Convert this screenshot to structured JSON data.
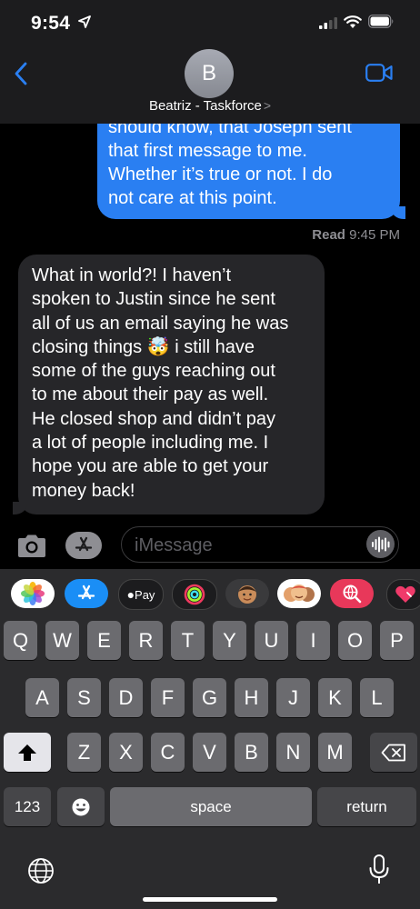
{
  "status_bar": {
    "time": "9:54"
  },
  "header": {
    "avatar_initial": "B",
    "contact_name": "Beatriz - Taskforce",
    "chevron": ">"
  },
  "messages": {
    "outgoing": {
      "lines": [
        "should know, that Joseph sent",
        "that first message to me.",
        "Whether it’s true or not. I do",
        "not care at this point."
      ]
    },
    "read_receipt": {
      "label": "Read",
      "time": "9:45 PM"
    },
    "incoming": {
      "lines": [
        "What in world?!  I haven’t",
        "spoken to Justin since he sent",
        "all of us an email saying he was",
        "closing things 🤯 i still have",
        "some of the guys reaching out",
        "to me about their pay as well.",
        "He closed shop and didn’t pay",
        "a lot of people including me. I",
        "hope you are able to get your",
        "money back!"
      ]
    }
  },
  "composer": {
    "placeholder": "iMessage"
  },
  "app_strip": {
    "items": [
      {
        "name": "photos-app-icon",
        "label": ""
      },
      {
        "name": "app-store-icon",
        "label": ""
      },
      {
        "name": "apple-pay-icon",
        "label": "Pay"
      },
      {
        "name": "activity-icon",
        "label": ""
      },
      {
        "name": "memoji-icon",
        "label": ""
      },
      {
        "name": "memoji-stickers-icon",
        "label": ""
      },
      {
        "name": "image-search-icon",
        "label": ""
      },
      {
        "name": "digital-touch-icon",
        "label": ""
      }
    ]
  },
  "keyboard": {
    "row1": [
      "Q",
      "W",
      "E",
      "R",
      "T",
      "Y",
      "U",
      "I",
      "O",
      "P"
    ],
    "row2": [
      "A",
      "S",
      "D",
      "F",
      "G",
      "H",
      "J",
      "K",
      "L"
    ],
    "row3": [
      "Z",
      "X",
      "C",
      "V",
      "B",
      "N",
      "M"
    ],
    "numbers_label": "123",
    "space_label": "space",
    "return_label": "return"
  },
  "colors": {
    "outgoing_bubble": "#2a7ff2",
    "incoming_bubble": "#262629",
    "accent": "#2a7ff2",
    "keyboard_bg": "#2b2b2d"
  }
}
